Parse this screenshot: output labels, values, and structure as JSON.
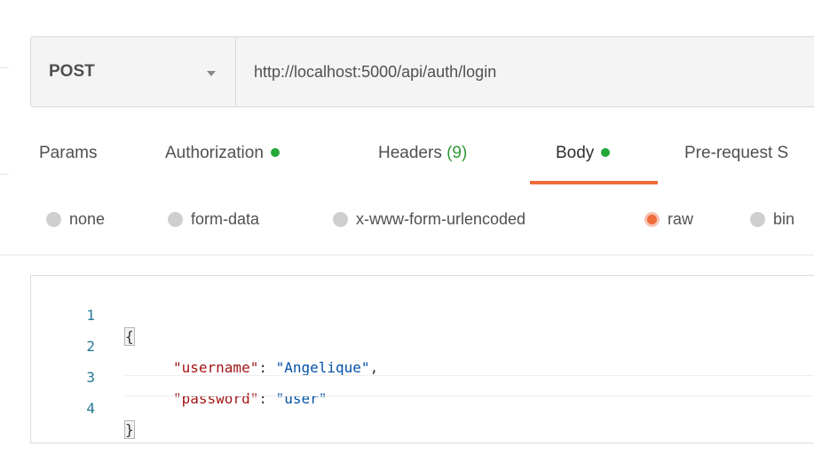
{
  "request": {
    "method": "POST",
    "url": "http://localhost:5000/api/auth/login"
  },
  "tabs": [
    {
      "label": "Params"
    },
    {
      "label": "Authorization",
      "indicator": "green-dot"
    },
    {
      "label": "Headers",
      "count": "(9)"
    },
    {
      "label": "Body",
      "indicator": "green-dot",
      "active": true
    },
    {
      "label": "Pre-request S"
    }
  ],
  "body_modes": [
    {
      "label": "none"
    },
    {
      "label": "form-data"
    },
    {
      "label": "x-www-form-urlencoded"
    },
    {
      "label": "raw",
      "selected": true
    },
    {
      "label": "bin"
    }
  ],
  "editor": {
    "lines": [
      {
        "number": "1",
        "open": "{"
      },
      {
        "number": "2",
        "key": "\"username\"",
        "sep": ": ",
        "value": "\"Angelique\"",
        "end": ","
      },
      {
        "number": "3",
        "key": "\"password\"",
        "sep": ": ",
        "value": "\"user\""
      },
      {
        "number": "4",
        "close": "}"
      }
    ]
  },
  "colors": {
    "accent": "#ee6c3a",
    "indicator_green": "#24a838",
    "json_key": "#a31515",
    "json_string": "#0451a5",
    "line_number": "#237893"
  }
}
